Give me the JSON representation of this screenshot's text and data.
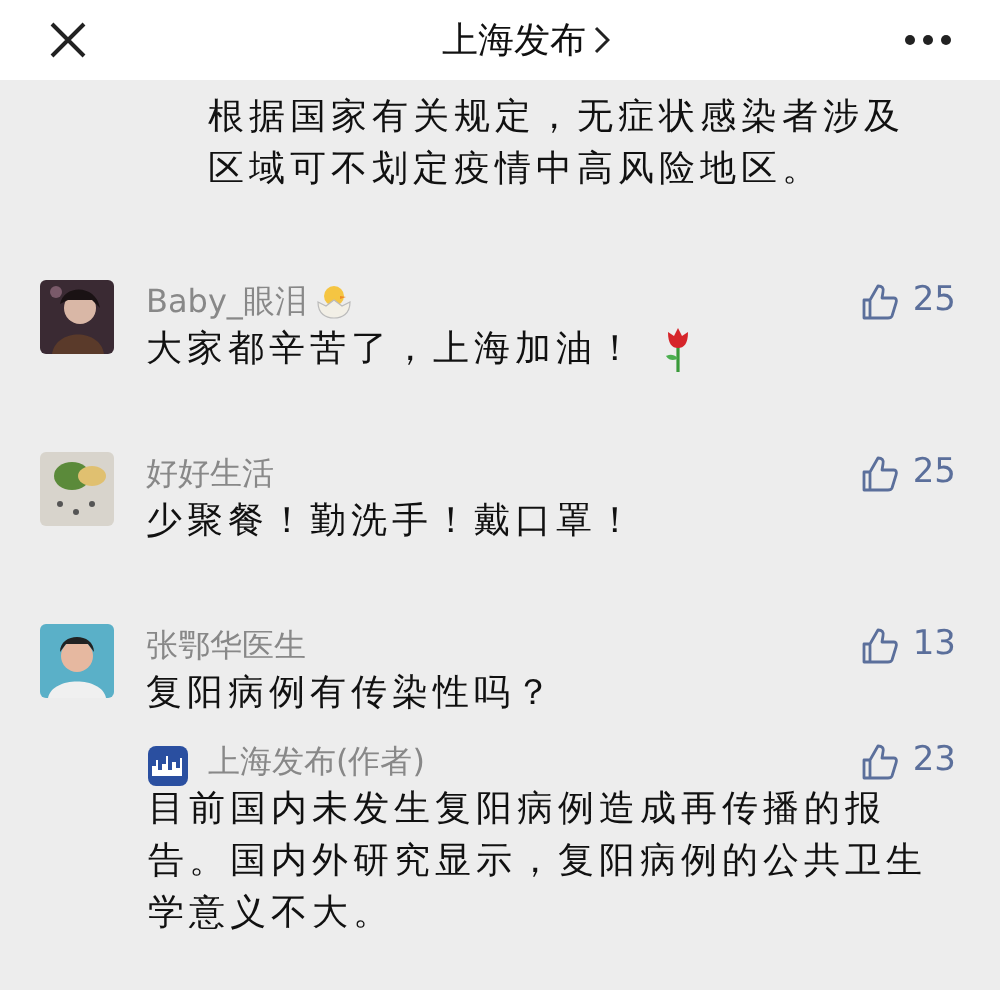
{
  "header": {
    "title": "上海发布"
  },
  "items": [
    {
      "kind": "reply",
      "text": "根据国家有关规定，无症状感染者涉及区域可不划定疫情中高风险地区。"
    },
    {
      "kind": "comment",
      "name": "Baby_眼泪",
      "chick_badge": true,
      "likes": "25",
      "text": "大家都辛苦了，上海加油！",
      "rose_emoji": true
    },
    {
      "kind": "comment",
      "name": "好好生活",
      "likes": "25",
      "text": "少聚餐！勤洗手！戴口罩！"
    },
    {
      "kind": "comment",
      "name": "张鄂华医生",
      "likes": "13",
      "text": "复阳病例有传染性吗？"
    },
    {
      "kind": "reply",
      "name": "上海发布(作者)",
      "likes": "23",
      "text": "目前国内未发生复阳病例造成再传播的报告。国内外研究显示，复阳病例的公共卫生学意义不大。"
    }
  ]
}
